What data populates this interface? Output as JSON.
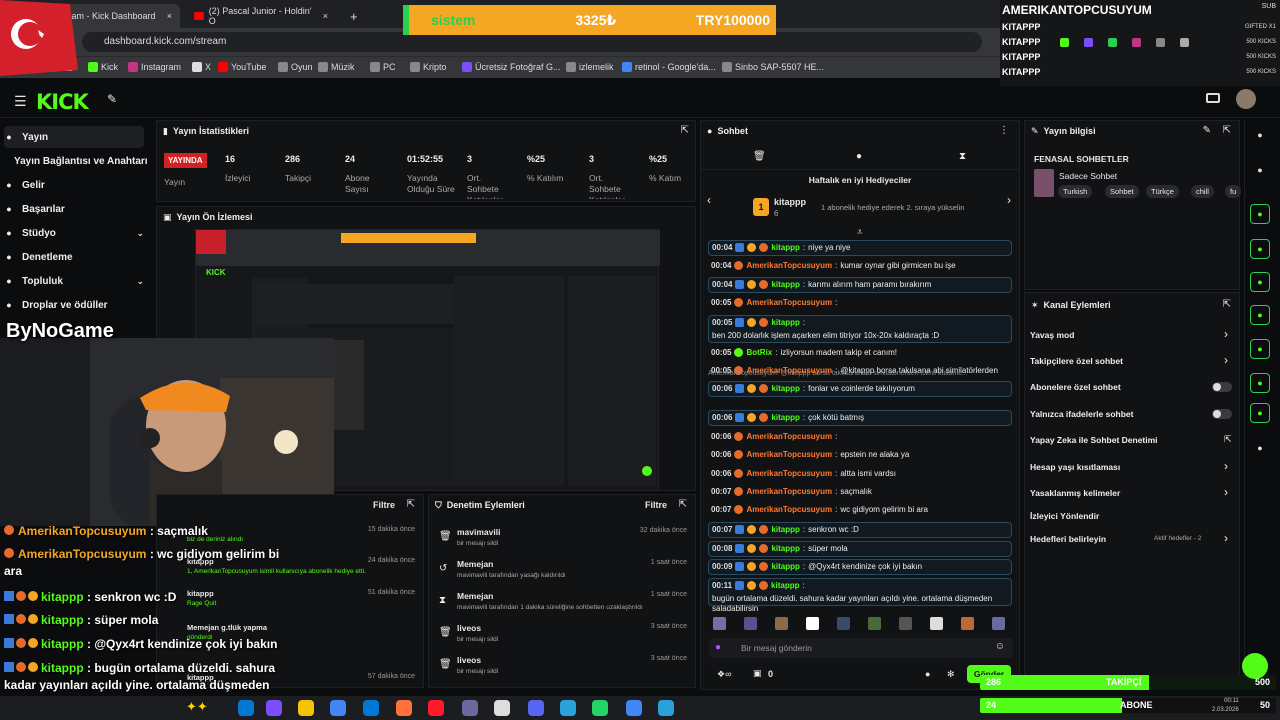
{
  "browser": {
    "tabs": [
      {
        "label": "Stream - Kick Dashboard",
        "close": "×"
      },
      {
        "label": "(2) Pascal Junior - Holdin' O",
        "close": "×"
      }
    ],
    "new_tab": "+",
    "url": "dashboard.kick.com/stream",
    "bookmarks": [
      "Kick",
      "Instagram",
      "X",
      "YouTube",
      "Oyun",
      "Müzik",
      "PC",
      "Kripto",
      "Ücretsiz Fotoğraf G...",
      "izlemelik",
      "retinol - Google'da...",
      "Sinbo SAP-5507 HE..."
    ]
  },
  "ticker": {
    "label": "sistem",
    "value": "3325₺",
    "goal": "TRY100000"
  },
  "top_right_overlay": {
    "title": "AMERIKANTOPCUSUYUM",
    "sub": "SUB",
    "rows": [
      {
        "name": "KITAPPP",
        "right": "GIFTED X1"
      },
      {
        "name": "KITAPPP",
        "right": "500 KICKS"
      },
      {
        "name": "KITAPPP",
        "right": "500 KICKS"
      },
      {
        "name": "KITAPPP",
        "right": "500 KICKS"
      }
    ]
  },
  "sidebar": {
    "items": [
      {
        "label": "Yayın",
        "icon": "broadcast-icon"
      },
      {
        "label": "Yayın Bağlantısı ve Anahtarı",
        "icon": ""
      },
      {
        "label": "Gelir",
        "icon": "revenue-icon"
      },
      {
        "label": "Başarılar",
        "icon": "trophy-icon"
      },
      {
        "label": "Stüdyo",
        "icon": "studio-icon"
      },
      {
        "label": "Denetleme",
        "icon": "moderation-icon"
      },
      {
        "label": "Topluluk",
        "icon": "community-icon"
      },
      {
        "label": "Droplar ve ödüller",
        "icon": "drops-icon"
      }
    ]
  },
  "stats": {
    "title": "Yayın İstatistikleri",
    "live_badge": "YAYINDA",
    "items": [
      {
        "value": "16",
        "label": "İzleyici"
      },
      {
        "value": "286",
        "label": "Takipçi"
      },
      {
        "value": "24",
        "label": "Abone Sayısı"
      },
      {
        "value": "01:52:55",
        "label": "Yayında Olduğu Süre"
      },
      {
        "value": "3",
        "label": "Ort. Sohbete Katılanlar"
      },
      {
        "value": "%25",
        "label": "% Katılım"
      },
      {
        "value": "3",
        "label": "Ort. Sohbete Katılanlar"
      },
      {
        "value": "%25",
        "label": "% Katım"
      }
    ],
    "first_label": "Yayın"
  },
  "preview": {
    "title": "Yayın Ön İzlemesi"
  },
  "watermark": "ByNoGame",
  "activity": {
    "filter": "Filtre",
    "items": [
      {
        "time": "15 dakika önce",
        "text": "biz de deriniz alındı"
      },
      {
        "time": "24 dakika önce",
        "name": "kitappp",
        "text": "1, AmerikanTopcusuyum isimli kullanıcıya abonelik hediye etti."
      },
      {
        "time": "51 dakika önce",
        "name": "kitappp",
        "text": "Rage Quit"
      },
      {
        "time": "",
        "name": "Memejan g.tlük yapma",
        "text": "gönderdi"
      },
      {
        "time": "57 dakika önce",
        "name": "kitappp",
        "text": ""
      }
    ]
  },
  "mod_actions": {
    "title": "Denetim Eylemleri",
    "filter": "Filtre",
    "items": [
      {
        "name": "mavimavili",
        "text": "bir mesajı sildi",
        "time": "32 dakika önce",
        "icon": "trash-icon"
      },
      {
        "name": "Memejan",
        "text": "mavimavili tarafından yasağı kaldırıldı",
        "time": "1 saat önce",
        "icon": "undo-icon"
      },
      {
        "name": "Memejan",
        "text": "mavimavili tarafından 1 dakika süreliğine sohbetten uzaklaştırıldı",
        "time": "1 saat önce",
        "icon": "hourglass-icon"
      },
      {
        "name": "liveos",
        "text": "bir mesajı sildi",
        "time": "3 saat önce",
        "icon": "trash-icon"
      },
      {
        "name": "liveos",
        "text": "bir mesajı sildi",
        "time": "3 saat önce",
        "icon": "trash-icon"
      }
    ]
  },
  "chat": {
    "title": "Sohbet",
    "weekly_title": "Haftalık en iyi Hediyeciler",
    "top_gifter": {
      "rank": "1",
      "name": "kitappp",
      "count": "6",
      "note": "1 abonelik hediye ederek 2. sıraya yükselin"
    },
    "messages": [
      {
        "time": "00:04",
        "user": "kitappp",
        "kind": "k",
        "text": "niye ya niye",
        "box": true
      },
      {
        "time": "00:04",
        "user": "AmerikanTopcusuyum",
        "kind": "a",
        "text": "kumar oynar gibi girmicen bu işe",
        "box": false
      },
      {
        "time": "00:04",
        "user": "kitappp",
        "kind": "k",
        "text": "karımı alırım ham paramı bırakırım",
        "box": true
      },
      {
        "time": "00:05",
        "user": "AmerikanTopcusuyum",
        "kind": "a",
        "text": "",
        "box": false
      },
      {
        "time": "00:05",
        "user": "kitappp",
        "kind": "k",
        "text": "ben 200 dolarlık işlem açarken elim titriyor 10x-20x kaldıraçta :D",
        "box": true
      },
      {
        "time": "00:05",
        "user": "BotRix",
        "kind": "b",
        "text": "izliyorsun madem takip et canım!",
        "box": false
      },
      {
        "time": "00:05",
        "user": "AmerikanTopcusuyum",
        "kind": "a",
        "text": "@kitappp borsa takılsana abi similatörlerden",
        "box": false
      },
      {
        "time": "00:06",
        "user": "kitappp",
        "kind": "k",
        "text": "fonlar ve coinlerde takılıyorum",
        "box": true,
        "reply": "AmerikanTopcusuyum: @kitappp borsa takılsana abi similatörlerden isimli kullanıc..."
      },
      {
        "time": "00:06",
        "user": "kitappp",
        "kind": "k",
        "text": "çok kötü batmış",
        "box": true
      },
      {
        "time": "00:06",
        "user": "AmerikanTopcusuyum",
        "kind": "a",
        "text": "",
        "box": false
      },
      {
        "time": "00:06",
        "user": "AmerikanTopcusuyum",
        "kind": "a",
        "text": "epstein ne alaka ya",
        "box": false
      },
      {
        "time": "00:06",
        "user": "AmerikanTopcusuyum",
        "kind": "a",
        "text": "altta ismi vardsı",
        "box": false
      },
      {
        "time": "00:07",
        "user": "AmerikanTopcusuyum",
        "kind": "a",
        "text": "saçmalık",
        "box": false
      },
      {
        "time": "00:07",
        "user": "AmerikanTopcusuyum",
        "kind": "a",
        "text": "wc gidiyom gelirim bi ara",
        "box": false
      },
      {
        "time": "00:07",
        "user": "kitappp",
        "kind": "k",
        "text": "senkron wc :D",
        "box": true
      },
      {
        "time": "00:08",
        "user": "kitappp",
        "kind": "k",
        "text": "süper mola",
        "box": true
      },
      {
        "time": "00:09",
        "user": "kitappp",
        "kind": "k",
        "text": "@Qyx4rt kendinize çok iyi bakın",
        "box": true
      },
      {
        "time": "00:11",
        "user": "kitappp",
        "kind": "k",
        "text": "bugün ortalama düzeldi. sahura kadar yayınları açıldı yine. ortalama düşmeden saladabilirsin",
        "box": true
      }
    ],
    "input_placeholder": "Bir mesaj gönderin",
    "kicks_count": "0",
    "send": "Gönder"
  },
  "stream_info": {
    "title": "Yayın bilgisi",
    "stream_title": "FENASAL SOHBETLER",
    "category": "Sadece Sohbet",
    "tags": [
      "Turkish",
      "Sohbet",
      "Türkçe",
      "chill",
      "fu"
    ]
  },
  "channel_actions": {
    "title": "Kanal Eylemleri",
    "items": [
      {
        "label": "Yavaş mod",
        "control": "chevron"
      },
      {
        "label": "Takipçilere özel sohbet",
        "control": "chevron"
      },
      {
        "label": "Abonelere özel sohbet",
        "control": "toggle"
      },
      {
        "label": "Yalnızca ifadelerle sohbet",
        "control": "toggle"
      },
      {
        "label": "Yapay Zeka ile Sohbet Denetimi",
        "control": "link"
      },
      {
        "label": "Hesap yaşı kısıtlaması",
        "control": "chevron"
      },
      {
        "label": "Yasaklanmış kelimeler",
        "control": "chevron"
      },
      {
        "label": "İzleyici Yönlendir",
        "control": "none"
      },
      {
        "label": "Hedefleri belirleyin",
        "control": "chevron",
        "extra": "Aktif hedefler - 2"
      }
    ]
  },
  "overlay_chat": [
    {
      "user": "AmerikanTopcusuyum",
      "text": "saçmalık"
    },
    {
      "user": "AmerikanTopcusuyum",
      "text": "wc gidiyom gelirim bi ara"
    },
    {
      "user": "kitappp",
      "text": "senkron wc :D"
    },
    {
      "user": "kitappp",
      "text": "süper mola"
    },
    {
      "user": "kitappp",
      "text": "@Qyx4rt kendinize çok iyi bakın"
    },
    {
      "user": "kitappp",
      "text": "bugün ortalama düzeldi. sahura kadar yayınları açıldı yine. ortalama düşmeden saladabilirsin"
    }
  ],
  "bottom_bars": {
    "followers": {
      "current": "286",
      "label": "TAKİPÇİ",
      "goal": "500"
    },
    "subs": {
      "current": "24",
      "label": "ABONE",
      "goal": "50"
    }
  },
  "clock": {
    "time": "00:11",
    "date": "2.03.2026"
  },
  "colors": {
    "kick_green": "#53fc18",
    "accent_orange": "#f5a623",
    "panel_bg": "#111214"
  }
}
